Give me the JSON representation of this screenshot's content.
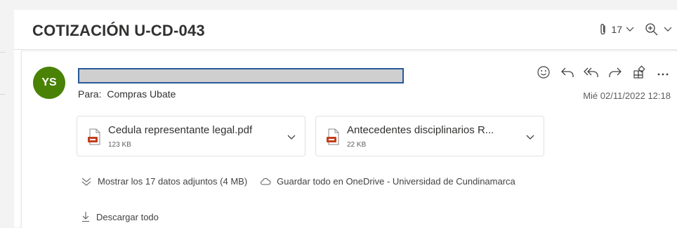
{
  "subject": "COTIZACIÓN U-CD-043",
  "toolbar": {
    "attachment_count": "17"
  },
  "sender": {
    "initials": "YS",
    "avatar_color": "#498205"
  },
  "recipient": {
    "to_label": "Para:",
    "to_name": "Compras Ubate"
  },
  "date": "Mié 02/11/2022 12:18",
  "attachments": [
    {
      "name": "Cedula representante legal.pdf",
      "size": "123 KB",
      "icon": "pdf-file-icon"
    },
    {
      "name": "Antecedentes disciplinarios R...",
      "size": "22 KB",
      "icon": "pdf-file-icon"
    }
  ],
  "links": {
    "show_all": "Mostrar los 17 datos adjuntos (4 MB)",
    "save_onedrive": "Guardar todo en OneDrive - Universidad de Cundinamarca",
    "download_all": "Descargar todo"
  },
  "icons": {
    "reactions": "smiley-icon",
    "reply": "reply-icon",
    "reply_all": "reply-all-icon",
    "forward": "forward-icon",
    "apps": "apps-icon",
    "more": "more-icon"
  },
  "colors": {
    "accent": "#2b579a",
    "pdf_red": "#c43e1c"
  }
}
